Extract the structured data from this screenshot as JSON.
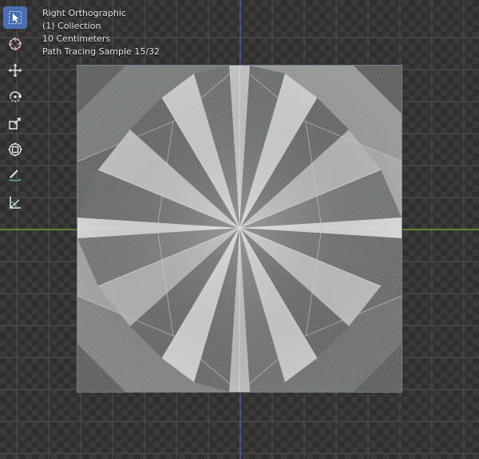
{
  "viewport": {
    "name": "3D Viewport",
    "mode": "Rendered"
  },
  "overlay": {
    "view_name": "Right Orthographic",
    "collection": "(1) Collection",
    "scale": "10 Centimeters",
    "render_status": "Path Tracing Sample 15/32"
  },
  "toolbar": {
    "tools": [
      {
        "icon": "select-box-icon",
        "active": true
      },
      {
        "icon": "cursor-icon",
        "active": false
      },
      {
        "icon": "move-icon",
        "active": false
      },
      {
        "icon": "rotate-icon",
        "active": false
      },
      {
        "icon": "scale-icon",
        "active": false
      },
      {
        "icon": "transform-icon",
        "active": false
      },
      {
        "icon": "annotate-icon",
        "active": false
      },
      {
        "icon": "measure-icon",
        "active": false
      }
    ]
  },
  "colors": {
    "axis_x": "#7fb040",
    "axis_z": "#3f6fb0",
    "active_tool": "#4a6fb5",
    "grid_line": "#505050"
  }
}
